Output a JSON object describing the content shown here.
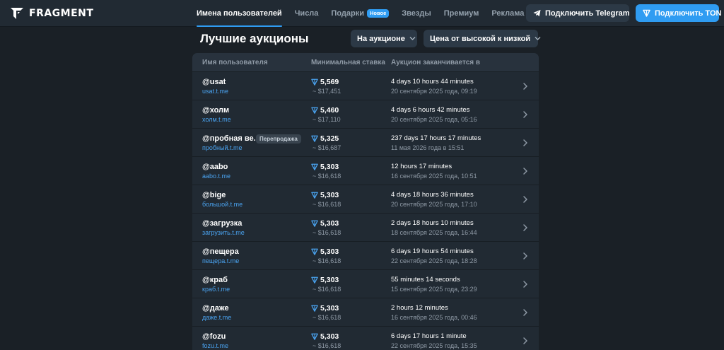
{
  "header": {
    "logo_text": "FRAGMENT",
    "nav": [
      {
        "label": "Имена пользователей",
        "active": true
      },
      {
        "label": "Числа"
      },
      {
        "label": "Подарки",
        "badge": "Новое"
      },
      {
        "label": "Звезды"
      },
      {
        "label": "Премиум"
      },
      {
        "label": "Реклама"
      }
    ],
    "connect_telegram_label": "Подключить Telegram",
    "connect_ton_label": "Подключить TON"
  },
  "main": {
    "title": "Лучшие аукционы",
    "status_filter": "На аукционе",
    "sort_filter": "Цена от высокой к низкой"
  },
  "table": {
    "columns": [
      "Имя пользователя",
      "Минимальная ставка",
      "Аукцион заканчивается в"
    ],
    "rows": [
      {
        "username": "@usat",
        "link": "usat.t.me",
        "bid": "5,569",
        "usd": "~ $17,451",
        "remaining": "4 days 10 hours 44 minutes",
        "ends": "20 сентября 2025 года, 09:19"
      },
      {
        "username": "@холм",
        "link": "холм.t.me",
        "bid": "5,460",
        "usd": "~ $17,110",
        "remaining": "4 days 6 hours 42 minutes",
        "ends": "20 сентября 2025 года, 05:16"
      },
      {
        "username": "@пробная ве...",
        "tag": "Перепродажа",
        "link": "пробный.t.me",
        "bid": "5,325",
        "usd": "~ $16,687",
        "remaining": "237 days 17 hours 17 minutes",
        "ends": "11 мая 2026 года в 15:51"
      },
      {
        "username": "@aabo",
        "link": "aabo.t.me",
        "bid": "5,303",
        "usd": "~ $16,618",
        "remaining": "12 hours 17 minutes",
        "ends": "16 сентября 2025 года, 10:51"
      },
      {
        "username": "@bige",
        "link": "большой.t.me",
        "bid": "5,303",
        "usd": "~ $16,618",
        "remaining": "4 days 18 hours 36 minutes",
        "ends": "20 сентября 2025 года, 17:10"
      },
      {
        "username": "@загрузка",
        "link": "загрузить.t.me",
        "bid": "5,303",
        "usd": "~ $16,618",
        "remaining": "2 days 18 hours 10 minutes",
        "ends": "18 сентября 2025 года, 16:44"
      },
      {
        "username": "@пещера",
        "link": "пещера.t.me",
        "bid": "5,303",
        "usd": "~ $16,618",
        "remaining": "6 days 19 hours 54 minutes",
        "ends": "22 сентября 2025 года, 18:28"
      },
      {
        "username": "@краб",
        "link": "краб.t.me",
        "bid": "5,303",
        "usd": "~ $16,618",
        "remaining": "55 minutes 14 seconds",
        "ends": "15 сентября 2025 года, 23:29"
      },
      {
        "username": "@даже",
        "link": "даже.t.me",
        "bid": "5,303",
        "usd": "~ $16,618",
        "remaining": "2 hours 12 minutes",
        "ends": "16 сентября 2025 года, 00:46"
      },
      {
        "username": "@fozu",
        "link": "fozu.t.me",
        "bid": "5,303",
        "usd": "~ $16,618",
        "remaining": "6 days 17 hours 1 minute",
        "ends": "22 сентября 2025 года, 15:35"
      }
    ]
  },
  "icons": {
    "logo": "fragment-logo-icon",
    "telegram": "paper-plane-icon",
    "ton": "ton-diamond-icon",
    "dropdown": "chevron-down-icon",
    "row_arrow": "chevron-right-icon"
  },
  "colors": {
    "background": "#1a2026",
    "header": "#212a33",
    "accent": "#2f9cf2",
    "link": "#4aa3f0",
    "muted": "#8f9aa6"
  }
}
